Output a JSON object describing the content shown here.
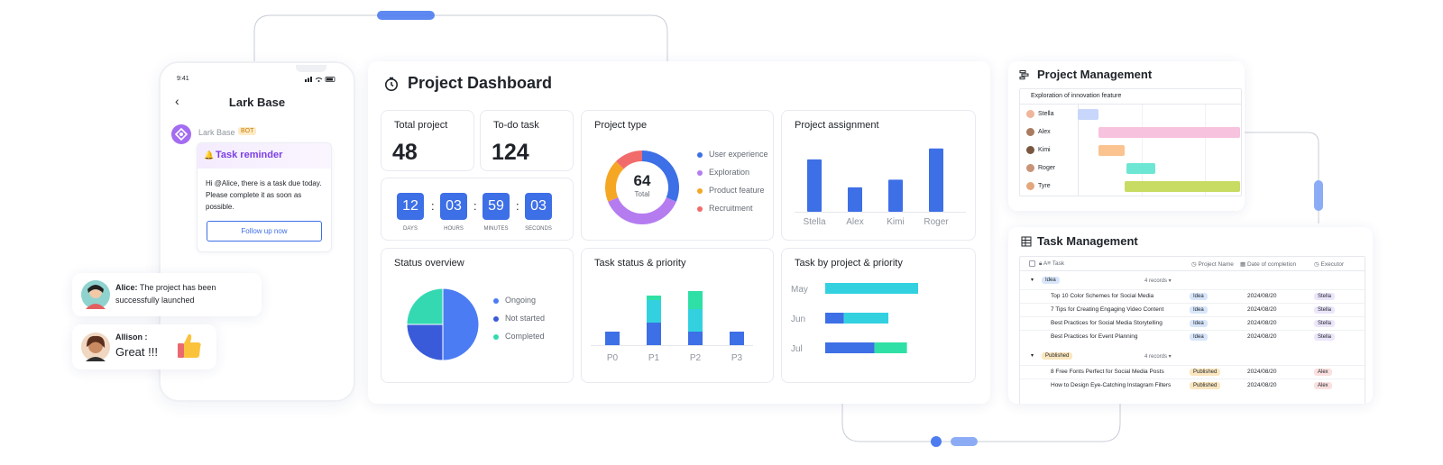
{
  "phone": {
    "status_time": "9:41",
    "back_icon": "chevron-left-icon",
    "title": "Lark Base",
    "bot_name": "Lark Base",
    "bot_badge": "BOT",
    "reminder_icon": "bell-icon",
    "reminder_title": "Task reminder",
    "reminder_text": "Hi @Alice, there is a task due today. Please complete it as soon as possible.",
    "follow_button": "Follow up now"
  },
  "chat": {
    "msg1_name": "Alice:",
    "msg1_text": "The project has been successfully launched",
    "msg2_name": "Allison :",
    "msg2_text": "Great !!!",
    "thumbs_icon": "thumbs-up-icon"
  },
  "dashboard": {
    "title_icon": "timer-icon",
    "title": "Project Dashboard",
    "total_project_label": "Total project",
    "total_project_value": "48",
    "todo_label": "To-do task",
    "todo_value": "124",
    "countdown": [
      {
        "value": "12",
        "label": "DAYS"
      },
      {
        "value": "03",
        "label": "HOURS"
      },
      {
        "value": "59",
        "label": "MINUTES"
      },
      {
        "value": "03",
        "label": "SECONDS"
      }
    ],
    "countdown_separator": ":",
    "project_type": {
      "title": "Project type",
      "center_value": "64",
      "center_label": "Total",
      "legend": [
        "User experience",
        "Exploration",
        "Product feature",
        "Recruitment"
      ],
      "colors": [
        "#3d6fe6",
        "#b57cf0",
        "#f5a623",
        "#f26b6b"
      ]
    },
    "project_assignment": {
      "title": "Project assignment"
    },
    "status_overview": {
      "title": "Status overview",
      "legend": [
        "Ongoing",
        "Not started",
        "Completed"
      ],
      "colors": [
        "#4b7cf3",
        "#3a5bd9",
        "#34d9b2"
      ]
    },
    "task_status": {
      "title": "Task status & priority"
    },
    "task_by_project": {
      "title": "Task by project & priority"
    }
  },
  "chart_data": [
    {
      "type": "pie",
      "title": "Project type",
      "categories": [
        "User experience",
        "Exploration",
        "Product feature",
        "Recruitment"
      ],
      "values": [
        20,
        24,
        12,
        8
      ],
      "total": 64
    },
    {
      "type": "bar",
      "title": "Project assignment",
      "categories": [
        "Stella",
        "Alex",
        "Kimi",
        "Roger"
      ],
      "values": [
        62,
        29,
        38,
        75
      ],
      "ylim": [
        0,
        80
      ]
    },
    {
      "type": "pie",
      "title": "Status overview",
      "categories": [
        "Ongoing",
        "Not started",
        "Completed"
      ],
      "values": [
        50,
        25,
        25
      ]
    },
    {
      "type": "bar",
      "title": "Task status & priority",
      "stacked": true,
      "categories": [
        "P0",
        "P1",
        "P2",
        "P3"
      ],
      "series": [
        {
          "values": [
            3,
            5,
            3,
            3
          ]
        },
        {
          "values": [
            0,
            5,
            5,
            0
          ]
        },
        {
          "values": [
            0,
            1,
            4,
            0
          ]
        }
      ],
      "colors": [
        "#3d6fe6",
        "#33d1e0",
        "#2fe0a6"
      ],
      "ylim": [
        0,
        14
      ]
    },
    {
      "type": "bar",
      "orientation": "horizontal",
      "stacked": true,
      "title": "Task by project & priority",
      "categories": [
        "May",
        "Jun",
        "Jul"
      ],
      "series": [
        {
          "values": [
            0,
            20,
            53
          ]
        },
        {
          "values": [
            100,
            48,
            0
          ]
        },
        {
          "values": [
            0,
            0,
            35
          ]
        }
      ],
      "colors": [
        "#3d6fe6",
        "#33d1e0",
        "#2fe0a6"
      ],
      "xlim": [
        0,
        100
      ]
    }
  ],
  "project_management": {
    "title_icon": "gantt-icon",
    "title": "Project Management",
    "header": "Exploration of innovation feature",
    "rows": [
      {
        "name": "Stella",
        "color": "#c9d6fb",
        "start": 0.0,
        "end": 0.13
      },
      {
        "name": "Alex",
        "color": "#f7c2dd",
        "start": 0.13,
        "end": 1.0
      },
      {
        "name": "Kimi",
        "color": "#fbc38f",
        "start": 0.13,
        "end": 0.29
      },
      {
        "name": "Roger",
        "color": "#6ee6d4",
        "start": 0.3,
        "end": 0.48
      },
      {
        "name": "Tyre",
        "color": "#c8dc63",
        "start": 0.29,
        "end": 1.0
      }
    ]
  },
  "task_management": {
    "title_icon": "table-icon",
    "title": "Task Management",
    "columns": {
      "task": "Task",
      "project": "Project Name",
      "date": "Date of completion",
      "executor": "Executor"
    },
    "groups": [
      {
        "name": "Idea",
        "records": "4 records",
        "tag_bg": "#d8e6fb",
        "rows": [
          {
            "task": "Top 10 Color Schemes for Social Media",
            "project": "Idea",
            "date": "2024/08/20",
            "executor": "Stella"
          },
          {
            "task": "7 Tips for Creating Engaging Video Content",
            "project": "Idea",
            "date": "2024/08/20",
            "executor": "Stella"
          },
          {
            "task": "Best Practices for Social Media Storytelling",
            "project": "Idea",
            "date": "2024/08/20",
            "executor": "Stella"
          },
          {
            "task": "Best Practices for Event Planning",
            "project": "Idea",
            "date": "2024/08/20",
            "executor": "Stella"
          }
        ]
      },
      {
        "name": "Published",
        "records": "4 records",
        "tag_bg": "#fbe6bf",
        "rows": [
          {
            "task": "8 Free Fonts Perfect for Social Media Posts",
            "project": "Published",
            "date": "2024/08/20",
            "executor": "Alex"
          },
          {
            "task": "How to Design Eye-Catching Instagram Filters",
            "project": "Published",
            "date": "2024/08/20",
            "executor": "Alex"
          }
        ]
      }
    ]
  }
}
